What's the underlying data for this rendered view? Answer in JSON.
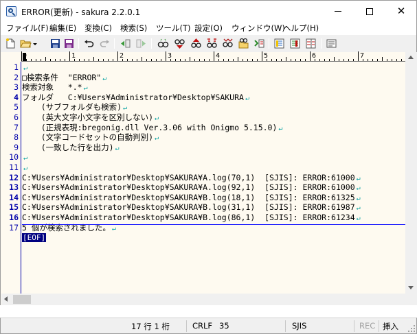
{
  "window": {
    "title": "ERROR(更新) - sakura 2.2.0.1",
    "minimize_label": "minimize",
    "maximize_label": "maximize",
    "close_label": "close"
  },
  "menu": {
    "items": [
      {
        "label": "ファイル(F)"
      },
      {
        "label": "編集(E)"
      },
      {
        "label": "変換(C)"
      },
      {
        "label": "検索(S)"
      },
      {
        "label": "ツール(T)"
      },
      {
        "label": "設定(O)"
      },
      {
        "label": "ウィンドウ(W)"
      },
      {
        "label": "ヘルプ(H)"
      }
    ]
  },
  "toolbar": {
    "icons": [
      "new-file-icon",
      "open-folder-icon",
      "save-icon",
      "save-as-icon",
      "undo-icon",
      "redo-icon",
      "back-icon",
      "forward-icon",
      "search-icon",
      "search-next-icon",
      "search-prev-icon",
      "replace-icon",
      "mark-icon",
      "grep-icon",
      "tag-jump-icon",
      "outline-icon",
      "function-list-icon",
      "compare-icon",
      "settings-icon"
    ]
  },
  "ruler": {
    "labels": [
      "0",
      "1",
      "2",
      "3",
      "4",
      "5",
      "6",
      "7"
    ]
  },
  "editor": {
    "line_numbers": [
      "1",
      "2",
      "3",
      "4",
      "5",
      "6",
      "7",
      "8",
      "9",
      "10",
      "11",
      "12",
      "13",
      "14",
      "15",
      "16",
      "17"
    ],
    "bold_line_numbers": [
      "4",
      "12",
      "13",
      "14",
      "15",
      "16"
    ],
    "lines": [
      "",
      "□検索条件  \"ERROR\"",
      "検索対象   *.*",
      "フォルダ   C:¥Users¥Administrator¥Desktop¥SAKURA",
      "    (サブフォルダも検索)",
      "    (英大文字小文字を区別しない)",
      "    (正規表現:bregonig.dll Ver.3.06 with Onigmo 5.15.0)",
      "    (文字コードセットの自動判別)",
      "    (一致した行を出力)",
      "",
      "",
      "C:¥Users¥Administrator¥Desktop¥SAKURA¥A.log(70,1)  [SJIS]: ERROR:61000",
      "C:¥Users¥Administrator¥Desktop¥SAKURA¥A.log(92,1)  [SJIS]: ERROR:61000",
      "C:¥Users¥Administrator¥Desktop¥SAKURA¥B.log(18,1)  [SJIS]: ERROR:61325",
      "C:¥Users¥Administrator¥Desktop¥SAKURA¥B.log(31,1)  [SJIS]: ERROR:61987",
      "C:¥Users¥Administrator¥Desktop¥SAKURA¥B.log(86,1)  [SJIS]: ERROR:61234",
      "5 個が検索されました。"
    ],
    "eof_label": "[EOF]",
    "eol_symbol": "↵"
  },
  "status": {
    "position": "17 行   1 桁",
    "line_ending": "CRLF",
    "char_code": "35",
    "encoding": "SJIS",
    "rec": "REC",
    "insert_mode": "挿入"
  },
  "colors": {
    "editor_bg": "#fefaf0",
    "line_number": "#0000aa",
    "eol_mark": "#00a0a0",
    "eof_bg": "#000080"
  }
}
